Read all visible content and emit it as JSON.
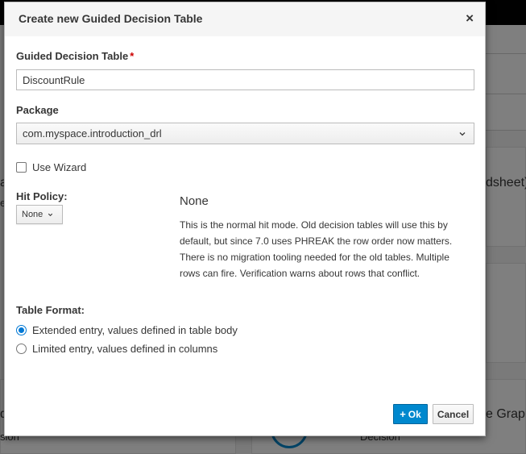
{
  "background": {
    "partial_texts": [
      "a",
      "e",
      "dsheet)",
      "d",
      "sion",
      "e Graph",
      "Decision"
    ]
  },
  "dialog": {
    "title": "Create new Guided Decision Table",
    "close_glyph": "×",
    "name_field": {
      "label": "Guided Decision Table",
      "required_marker": "*",
      "value": "DiscountRule"
    },
    "package_field": {
      "label": "Package",
      "value": "com.myspace.introduction_drl",
      "icon": "chevron-down-icon"
    },
    "use_wizard": {
      "label": "Use Wizard",
      "checked": false
    },
    "hit_policy": {
      "label": "Hit Policy:",
      "selected": "None",
      "title": "None",
      "description": "This is the normal hit mode. Old decision tables will use this by default, but since 7.0 uses PHREAK the row order now matters. There is no migration tooling needed for the old tables. Multiple rows can fire. Verification warns about rows that conflict."
    },
    "table_format": {
      "label": "Table Format:",
      "options": [
        {
          "label": "Extended entry, values defined in table body",
          "checked": true
        },
        {
          "label": "Limited entry, values defined in columns",
          "checked": false
        }
      ]
    },
    "buttons": {
      "ok_icon": "+",
      "ok_label": "Ok",
      "cancel_label": "Cancel"
    }
  },
  "colors": {
    "primary": "#0088ce",
    "required": "#cc0000",
    "overlay": "rgba(0,0,0,0.5)"
  }
}
